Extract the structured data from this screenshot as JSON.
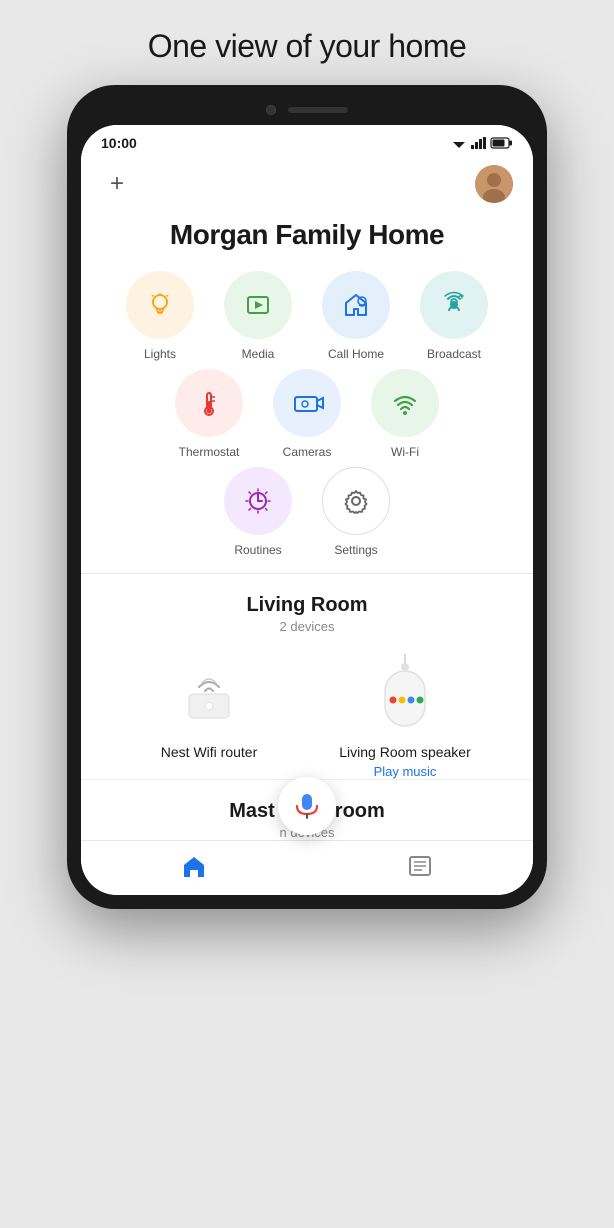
{
  "page": {
    "tagline": "One view of your home"
  },
  "statusBar": {
    "time": "10:00"
  },
  "header": {
    "addLabel": "+",
    "homeTitle": "Morgan Family Home"
  },
  "icons": {
    "row1": [
      {
        "id": "lights",
        "label": "Lights",
        "colorClass": "yellow"
      },
      {
        "id": "media",
        "label": "Media",
        "colorClass": "green"
      },
      {
        "id": "callhome",
        "label": "Call Home",
        "colorClass": "blue"
      },
      {
        "id": "broadcast",
        "label": "Broadcast",
        "colorClass": "teal"
      }
    ],
    "row2": [
      {
        "id": "thermostat",
        "label": "Thermostat",
        "colorClass": "red"
      },
      {
        "id": "cameras",
        "label": "Cameras",
        "colorClass": "blue2"
      },
      {
        "id": "wifi",
        "label": "Wi-Fi",
        "colorClass": "green2"
      }
    ],
    "row3": [
      {
        "id": "routines",
        "label": "Routines",
        "colorClass": "purple"
      },
      {
        "id": "settings",
        "label": "Settings",
        "colorClass": "white"
      }
    ]
  },
  "rooms": {
    "livingRoom": {
      "name": "Living Room",
      "deviceCount": "2 devices",
      "devices": [
        {
          "id": "nest-wifi",
          "name": "Nest Wifi router",
          "action": null
        },
        {
          "id": "living-room-speaker",
          "name": "Living Room speaker",
          "action": "Play music"
        }
      ]
    },
    "masterRoom": {
      "name": "Mast",
      "nameSuffix": "room",
      "deviceCount": "n devices"
    }
  },
  "nav": {
    "items": [
      {
        "id": "home",
        "label": "Home"
      },
      {
        "id": "assistant",
        "label": "Assistant"
      },
      {
        "id": "list",
        "label": "List"
      }
    ]
  },
  "colors": {
    "accent": "#1a73e8",
    "red": "#e53935",
    "green": "#43a047",
    "teal": "#26a69a",
    "purple": "#9c27b0",
    "blue": "#1a73e8"
  }
}
